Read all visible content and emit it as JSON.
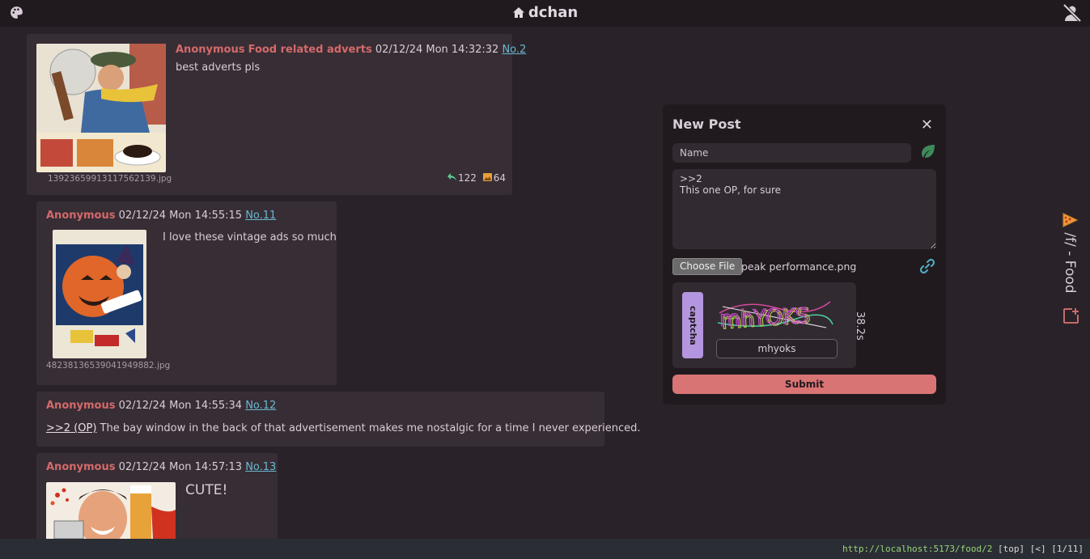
{
  "header": {
    "site_name": "dchan",
    "icons": [
      "palette-icon",
      "home-icon",
      "user-slash-icon"
    ]
  },
  "op": {
    "name": "Anonymous",
    "subject": "Food related adverts",
    "date": "02/12/24 Mon 14:32:32",
    "number": "No.2",
    "body": "best adverts pls",
    "filename": "1392365991311756213​9.jpg",
    "replies": "122",
    "images": "64"
  },
  "replies": [
    {
      "name": "Anonymous",
      "date": "02/12/24 Mon 14:55:15",
      "number": "No.11",
      "body": "I love these vintage ads so much",
      "filename": "48238136539041949882.jpg"
    },
    {
      "name": "Anonymous",
      "date": "02/12/24 Mon 14:55:34",
      "number": "No.12",
      "quote": ">>2 (OP)",
      "body": "The bay window in the back of that advertisement makes me nostalgic for a time I never experienced."
    },
    {
      "name": "Anonymous",
      "date": "02/12/24 Mon 14:57:13",
      "number": "No.13",
      "body": "CUTE!"
    }
  ],
  "new_post": {
    "title": "New Post",
    "close_label": "✕",
    "name_placeholder": "Name",
    "comment_value": ">>2\nThis one OP, for sure",
    "choose_file_label": "Choose File",
    "file_name": "peak performance.png",
    "captcha_label": "captcha",
    "captcha_text": "mhYOKS",
    "captcha_value": "mhyoks",
    "timer": "38.2s",
    "submit_label": "Submit"
  },
  "sidebar": {
    "board_title": "/f/ - Food"
  },
  "status": {
    "url": "http://localhost:5173/food/2",
    "controls": "[top] [<] [1/11]"
  }
}
